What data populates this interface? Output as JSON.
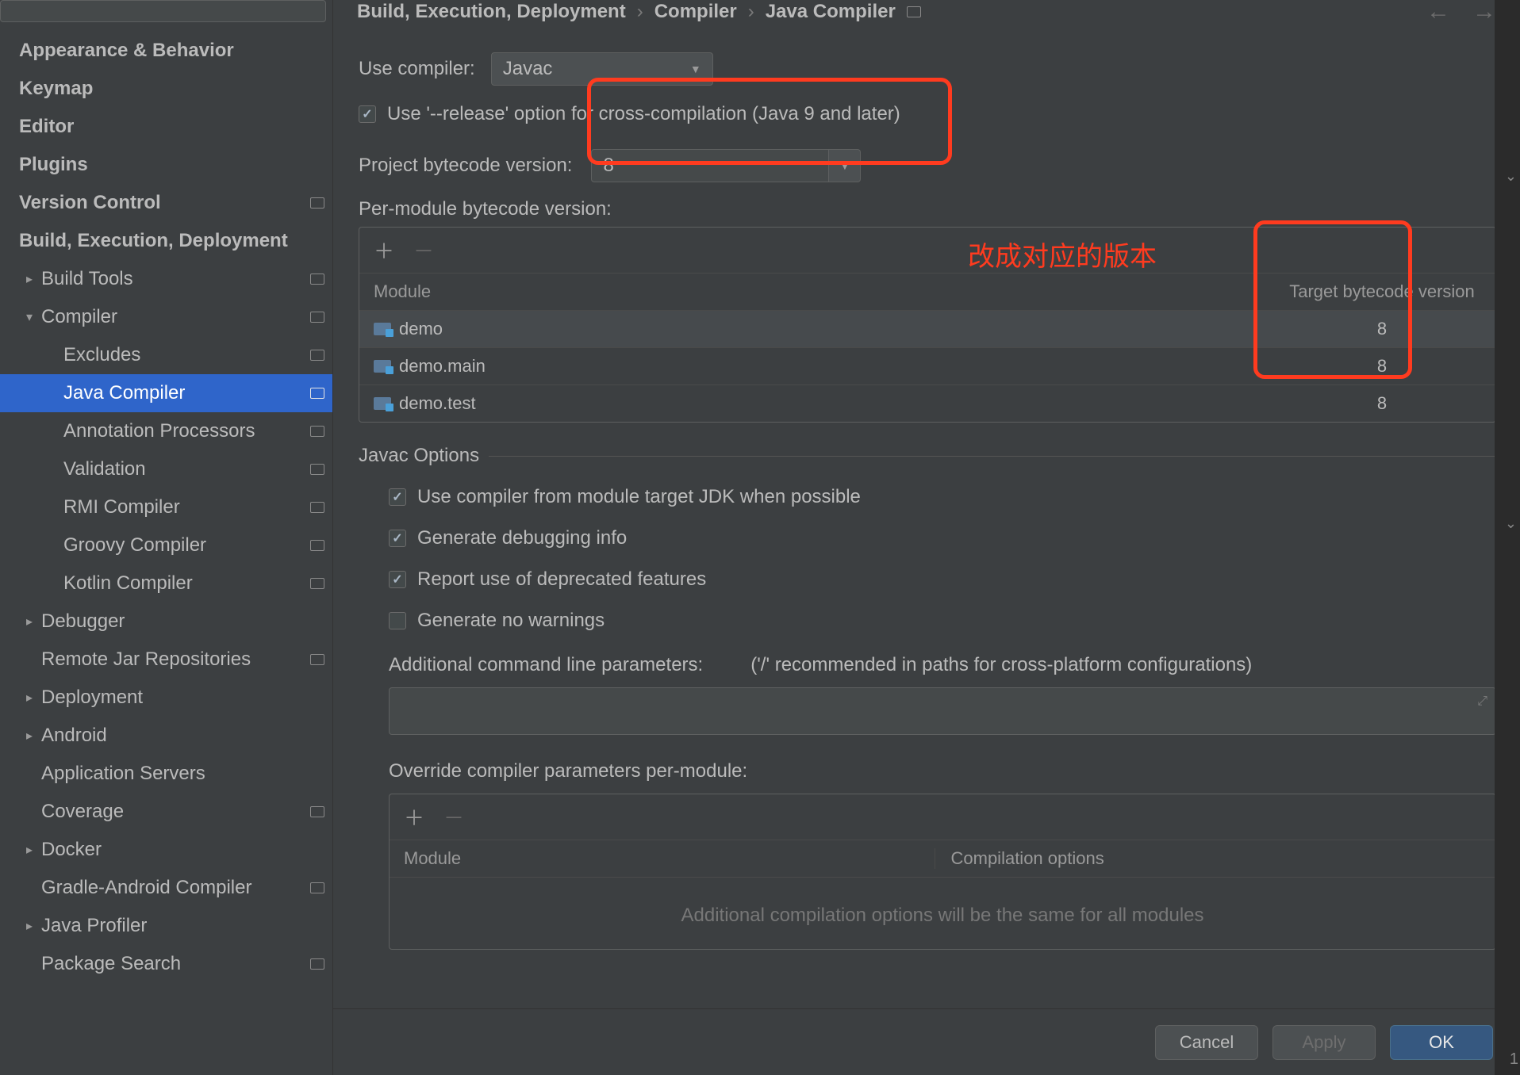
{
  "breadcrumb": {
    "a": "Build, Execution, Deployment",
    "b": "Compiler",
    "c": "Java Compiler"
  },
  "sidebar": {
    "items": [
      {
        "label": "Appearance & Behavior",
        "bold": true,
        "indent": 0,
        "arrow": "",
        "proj": false
      },
      {
        "label": "Keymap",
        "bold": true,
        "indent": 0,
        "arrow": "",
        "proj": false
      },
      {
        "label": "Editor",
        "bold": true,
        "indent": 0,
        "arrow": "",
        "proj": false
      },
      {
        "label": "Plugins",
        "bold": true,
        "indent": 0,
        "arrow": "",
        "proj": false
      },
      {
        "label": "Version Control",
        "bold": true,
        "indent": 0,
        "arrow": "",
        "proj": true
      },
      {
        "label": "Build, Execution, Deployment",
        "bold": true,
        "indent": 0,
        "arrow": "",
        "proj": false
      },
      {
        "label": "Build Tools",
        "bold": false,
        "indent": 1,
        "arrow": "▸",
        "proj": true
      },
      {
        "label": "Compiler",
        "bold": false,
        "indent": 1,
        "arrow": "▾",
        "proj": true
      },
      {
        "label": "Excludes",
        "bold": false,
        "indent": 2,
        "arrow": "",
        "proj": true
      },
      {
        "label": "Java Compiler",
        "bold": false,
        "indent": 2,
        "arrow": "",
        "proj": true,
        "selected": true
      },
      {
        "label": "Annotation Processors",
        "bold": false,
        "indent": 2,
        "arrow": "",
        "proj": true
      },
      {
        "label": "Validation",
        "bold": false,
        "indent": 2,
        "arrow": "",
        "proj": true
      },
      {
        "label": "RMI Compiler",
        "bold": false,
        "indent": 2,
        "arrow": "",
        "proj": true
      },
      {
        "label": "Groovy Compiler",
        "bold": false,
        "indent": 2,
        "arrow": "",
        "proj": true
      },
      {
        "label": "Kotlin Compiler",
        "bold": false,
        "indent": 2,
        "arrow": "",
        "proj": true
      },
      {
        "label": "Debugger",
        "bold": false,
        "indent": 1,
        "arrow": "▸",
        "proj": false
      },
      {
        "label": "Remote Jar Repositories",
        "bold": false,
        "indent": 1,
        "arrow": "",
        "proj": true
      },
      {
        "label": "Deployment",
        "bold": false,
        "indent": 1,
        "arrow": "▸",
        "proj": false
      },
      {
        "label": "Android",
        "bold": false,
        "indent": 1,
        "arrow": "▸",
        "proj": false
      },
      {
        "label": "Application Servers",
        "bold": false,
        "indent": 1,
        "arrow": "",
        "proj": false
      },
      {
        "label": "Coverage",
        "bold": false,
        "indent": 1,
        "arrow": "",
        "proj": true
      },
      {
        "label": "Docker",
        "bold": false,
        "indent": 1,
        "arrow": "▸",
        "proj": false
      },
      {
        "label": "Gradle-Android Compiler",
        "bold": false,
        "indent": 1,
        "arrow": "",
        "proj": true
      },
      {
        "label": "Java Profiler",
        "bold": false,
        "indent": 1,
        "arrow": "▸",
        "proj": false
      },
      {
        "label": "Package Search",
        "bold": false,
        "indent": 1,
        "arrow": "",
        "proj": true
      }
    ]
  },
  "main": {
    "use_compiler_label": "Use compiler:",
    "use_compiler_value": "Javac",
    "release_option": "Use '--release' option for cross-compilation (Java 9 and later)",
    "project_bytecode_label": "Project bytecode version:",
    "project_bytecode_value": "8",
    "per_module_label": "Per-module bytecode version:",
    "table": {
      "col_module": "Module",
      "col_version": "Target bytecode version",
      "rows": [
        {
          "module": "demo",
          "version": "8",
          "selected": true
        },
        {
          "module": "demo.main",
          "version": "8",
          "selected": false
        },
        {
          "module": "demo.test",
          "version": "8",
          "selected": false
        }
      ]
    },
    "javac_legend": "Javac Options",
    "opt1": "Use compiler from module target JDK when possible",
    "opt2": "Generate debugging info",
    "opt3": "Report use of deprecated features",
    "opt4": "Generate no warnings",
    "params_label": "Additional command line parameters:",
    "params_hint": "('/' recommended in paths for cross-platform configurations)",
    "override_label": "Override compiler parameters per-module:",
    "override_col1": "Module",
    "override_col2": "Compilation options",
    "override_hint": "Additional compilation options will be the same for all modules"
  },
  "footer": {
    "cancel": "Cancel",
    "apply": "Apply",
    "ok": "OK"
  },
  "annotation": {
    "text": "改成对应的版本"
  }
}
